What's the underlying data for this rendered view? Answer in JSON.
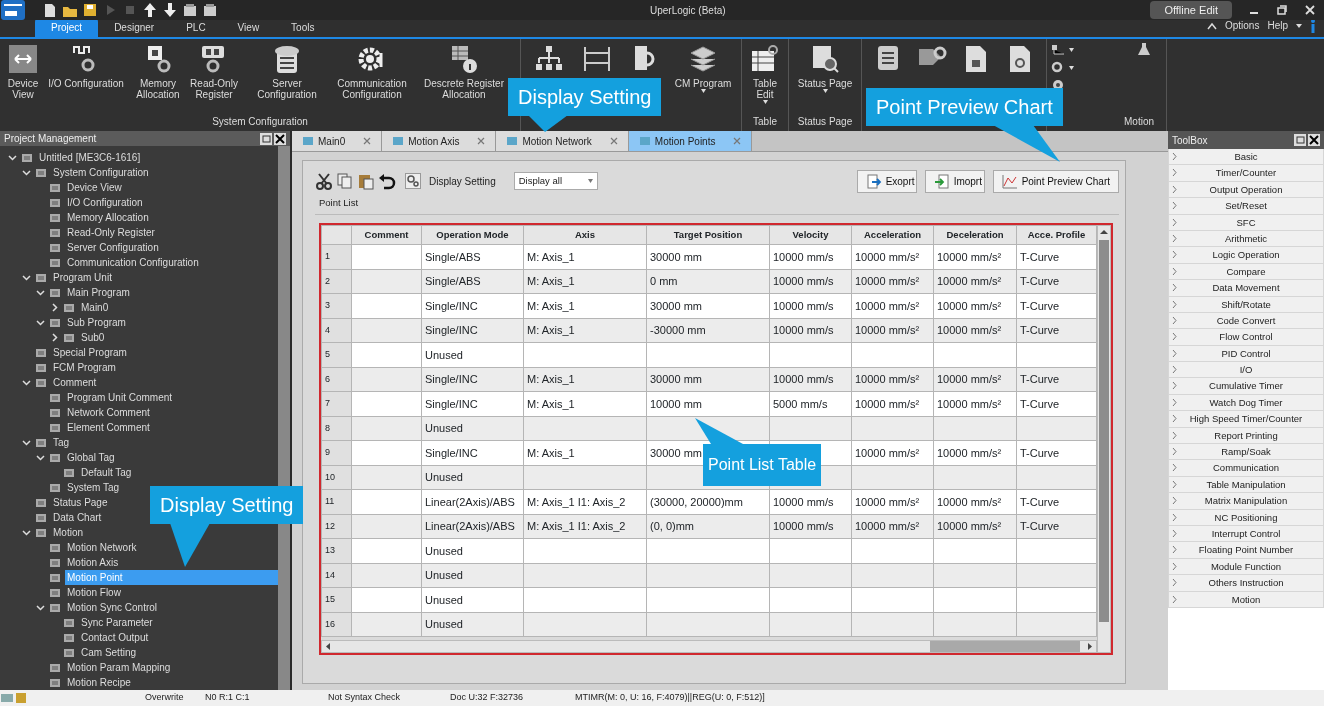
{
  "app": {
    "title": "UperLogic (Beta)",
    "mode": "Offline Edit"
  },
  "menu_tabs": [
    {
      "label": "Project",
      "selected": true
    },
    {
      "label": "Designer",
      "selected": false
    },
    {
      "label": "PLC",
      "selected": false
    },
    {
      "label": "View",
      "selected": false
    },
    {
      "label": "Tools",
      "selected": false
    }
  ],
  "menu_right": {
    "options": "Options",
    "help": "Help"
  },
  "ribbon_groups": [
    {
      "label": "System Configuration",
      "buttons": [
        {
          "label": "Device View",
          "dropdown": false
        },
        {
          "label": "I/O Configuration",
          "dropdown": false
        },
        {
          "label": "Memory Allocation",
          "dropdown": false
        },
        {
          "label": "Read-Only Register",
          "dropdown": false
        },
        {
          "label": "Server Configuration",
          "dropdown": false
        },
        {
          "label": "Communication Configuration",
          "dropdown": false
        },
        {
          "label": "Descrete Register Allocation",
          "dropdown": false
        }
      ]
    },
    {
      "buttons": [
        {
          "dropdown": false
        },
        {
          "dropdown": false
        },
        {
          "dropdown": false
        },
        {
          "label": "CM Program",
          "dropdown": true
        }
      ]
    },
    {
      "label": "Table",
      "buttons": [
        {
          "label": "Table Edit",
          "dropdown": true
        }
      ]
    },
    {
      "label": "Status Page",
      "buttons": [
        {
          "label": "Status Page",
          "dropdown": true
        }
      ]
    },
    {
      "buttons": [
        {
          "dropdown": false
        },
        {
          "dropdown": false
        },
        {
          "dropdown": false
        },
        {
          "dropdown": false
        }
      ]
    },
    {
      "label": "Motion",
      "buttons": [
        {
          "dropdown": true
        },
        {
          "dropdown": true
        },
        {
          "dropdown": false
        }
      ]
    }
  ],
  "project_panel": {
    "title": "Project Management",
    "tree": [
      {
        "label": "Untitled [ME3C6-1616]",
        "expanded": true,
        "selected": false,
        "children": [
          {
            "label": "System Configuration",
            "expanded": true,
            "selected": false,
            "children": [
              {
                "label": "Device View",
                "selected": false
              },
              {
                "label": "I/O Configuration",
                "selected": false
              },
              {
                "label": "Memory Allocation",
                "selected": false
              },
              {
                "label": "Read-Only Register",
                "selected": false
              },
              {
                "label": "Server Configuration",
                "selected": false
              },
              {
                "label": "Communication Configuration",
                "selected": false
              }
            ]
          },
          {
            "label": "Program Unit",
            "expanded": true,
            "selected": false,
            "children": [
              {
                "label": "Main Program",
                "expanded": true,
                "selected": false,
                "children": [
                  {
                    "label": "Main0",
                    "expanded": false,
                    "selected": false
                  }
                ]
              },
              {
                "label": "Sub Program",
                "expanded": true,
                "selected": false,
                "children": [
                  {
                    "label": "Sub0",
                    "expanded": false,
                    "selected": false
                  }
                ]
              }
            ]
          },
          {
            "label": "Special Program",
            "selected": false
          },
          {
            "label": "FCM Program",
            "selected": false
          },
          {
            "label": "Comment",
            "expanded": true,
            "selected": false,
            "children": [
              {
                "label": "Program Unit Comment",
                "selected": false
              },
              {
                "label": "Network Comment",
                "selected": false
              },
              {
                "label": "Element Comment",
                "selected": false
              }
            ]
          },
          {
            "label": "Tag",
            "expanded": true,
            "selected": false,
            "children": [
              {
                "label": "Global Tag",
                "expanded": true,
                "selected": false,
                "children": [
                  {
                    "label": "Default Tag",
                    "selected": false
                  }
                ]
              },
              {
                "label": "System Tag",
                "selected": false
              }
            ]
          },
          {
            "label": "Status Page",
            "selected": false
          },
          {
            "label": "Data Chart",
            "selected": false
          },
          {
            "label": "Motion",
            "expanded": true,
            "selected": false,
            "children": [
              {
                "label": "Motion Network",
                "selected": false
              },
              {
                "label": "Motion Axis",
                "selected": false
              },
              {
                "label": "Motion Point",
                "selected": true
              },
              {
                "label": "Motion Flow",
                "selected": false
              },
              {
                "label": "Motion Sync Control",
                "expanded": true,
                "selected": false,
                "children": [
                  {
                    "label": "Sync Parameter",
                    "selected": false
                  },
                  {
                    "label": "Contact Output",
                    "selected": false
                  },
                  {
                    "label": "Cam Setting",
                    "selected": false
                  }
                ]
              },
              {
                "label": "Motion Param Mapping",
                "selected": false
              },
              {
                "label": "Motion Recipe",
                "selected": false
              }
            ]
          }
        ]
      }
    ]
  },
  "doc_tabs": [
    {
      "label": "Main0",
      "selected": false
    },
    {
      "label": "Motion Axis",
      "selected": false
    },
    {
      "label": "Motion Network",
      "selected": false
    },
    {
      "label": "Motion Points",
      "selected": true
    }
  ],
  "toolbar": {
    "display_setting": "Display Setting",
    "display_value": "Display all",
    "buttons": [
      "Exoprt",
      "Imoprt",
      "Point Preview Chart"
    ]
  },
  "point_list": {
    "title": "Point List",
    "columns": [
      "Comment",
      "Operation Mode",
      "Axis",
      "Target Position",
      "Velocity",
      "Acceleration",
      "Deceleration",
      "Acce. Profile"
    ],
    "rows": [
      {
        "no": "1",
        "mode": "Single/ABS",
        "axis": "M: Axis_1",
        "target": "30000 mm",
        "velocity": "10000 mm/s",
        "acceleration": "10000 mm/s²",
        "deceleration": "10000 mm/s²",
        "profile": "T-Curve"
      },
      {
        "no": "2",
        "mode": "Single/ABS",
        "axis": "M: Axis_1",
        "target": "0 mm",
        "velocity": "10000 mm/s",
        "acceleration": "10000 mm/s²",
        "deceleration": "10000 mm/s²",
        "profile": "T-Curve"
      },
      {
        "no": "3",
        "mode": "Single/INC",
        "axis": "M: Axis_1",
        "target": "30000 mm",
        "velocity": "10000 mm/s",
        "acceleration": "10000 mm/s²",
        "deceleration": "10000 mm/s²",
        "profile": "T-Curve"
      },
      {
        "no": "4",
        "mode": "Single/INC",
        "axis": "M: Axis_1",
        "target": "-30000 mm",
        "velocity": "10000 mm/s",
        "acceleration": "10000 mm/s²",
        "deceleration": "10000 mm/s²",
        "profile": "T-Curve"
      },
      {
        "no": "5",
        "mode": "Unused"
      },
      {
        "no": "6",
        "mode": "Single/INC",
        "axis": "M: Axis_1",
        "target": "30000 mm",
        "velocity": "10000 mm/s",
        "acceleration": "10000 mm/s²",
        "deceleration": "10000 mm/s²",
        "profile": "T-Curve"
      },
      {
        "no": "7",
        "mode": "Single/INC",
        "axis": "M: Axis_1",
        "target": "10000 mm",
        "velocity": "5000 mm/s",
        "acceleration": "10000 mm/s²",
        "deceleration": "10000 mm/s²",
        "profile": "T-Curve"
      },
      {
        "no": "8",
        "mode": "Unused"
      },
      {
        "no": "9",
        "mode": "Single/INC",
        "axis": "M: Axis_1",
        "target": "30000 mm",
        "acceleration": "10000 mm/s²",
        "deceleration": "10000 mm/s²",
        "profile": "T-Curve"
      },
      {
        "no": "10",
        "mode": "Unused"
      },
      {
        "no": "11",
        "mode": "Linear(2Axis)/ABS",
        "axis": "M: Axis_1 I1: Axis_2",
        "target": "(30000, 20000)mm",
        "velocity": "10000 mm/s",
        "acceleration": "10000 mm/s²",
        "deceleration": "10000 mm/s²",
        "profile": "T-Curve"
      },
      {
        "no": "12",
        "mode": "Linear(2Axis)/ABS",
        "axis": "M: Axis_1 I1: Axis_2",
        "target": "(0, 0)mm",
        "velocity": "10000 mm/s",
        "acceleration": "10000 mm/s²",
        "deceleration": "10000 mm/s²",
        "profile": "T-Curve"
      },
      {
        "no": "13",
        "mode": "Unused"
      },
      {
        "no": "14",
        "mode": "Unused"
      },
      {
        "no": "15",
        "mode": "Unused"
      },
      {
        "no": "16",
        "mode": "Unused"
      }
    ]
  },
  "toolbox": {
    "title": "ToolBox",
    "items": [
      "Basic",
      "Timer/Counter",
      "Output Operation",
      "Set/Reset",
      "SFC",
      "Arithmetic",
      "Logic Operation",
      "Compare",
      "Data Movement",
      "Shift/Rotate",
      "Code Convert",
      "Flow Control",
      "PID Control",
      "I/O",
      "Cumulative Timer",
      "Watch Dog Timer",
      "High Speed Timer/Counter",
      "Report Printing",
      "Ramp/Soak",
      "Communication",
      "Table Manipulation",
      "Matrix Manipulation",
      "NC Positioning",
      "Interrupt Control",
      "Floating Point Number",
      "Module Function",
      "Others Instruction",
      "Motion"
    ]
  },
  "callouts": [
    {
      "text": "Display Setting"
    },
    {
      "text": "Point Preview Chart"
    },
    {
      "text": "Point List Table"
    },
    {
      "text": "Display Setting"
    }
  ],
  "status_bar": [
    "Overwrite",
    "N0 R:1 C:1",
    "Not Syntax Check",
    "Doc U:32 F:32736",
    "MTIMR(M: 0, U: 16, F:4079)||REG(U: 0, F:512)]"
  ]
}
